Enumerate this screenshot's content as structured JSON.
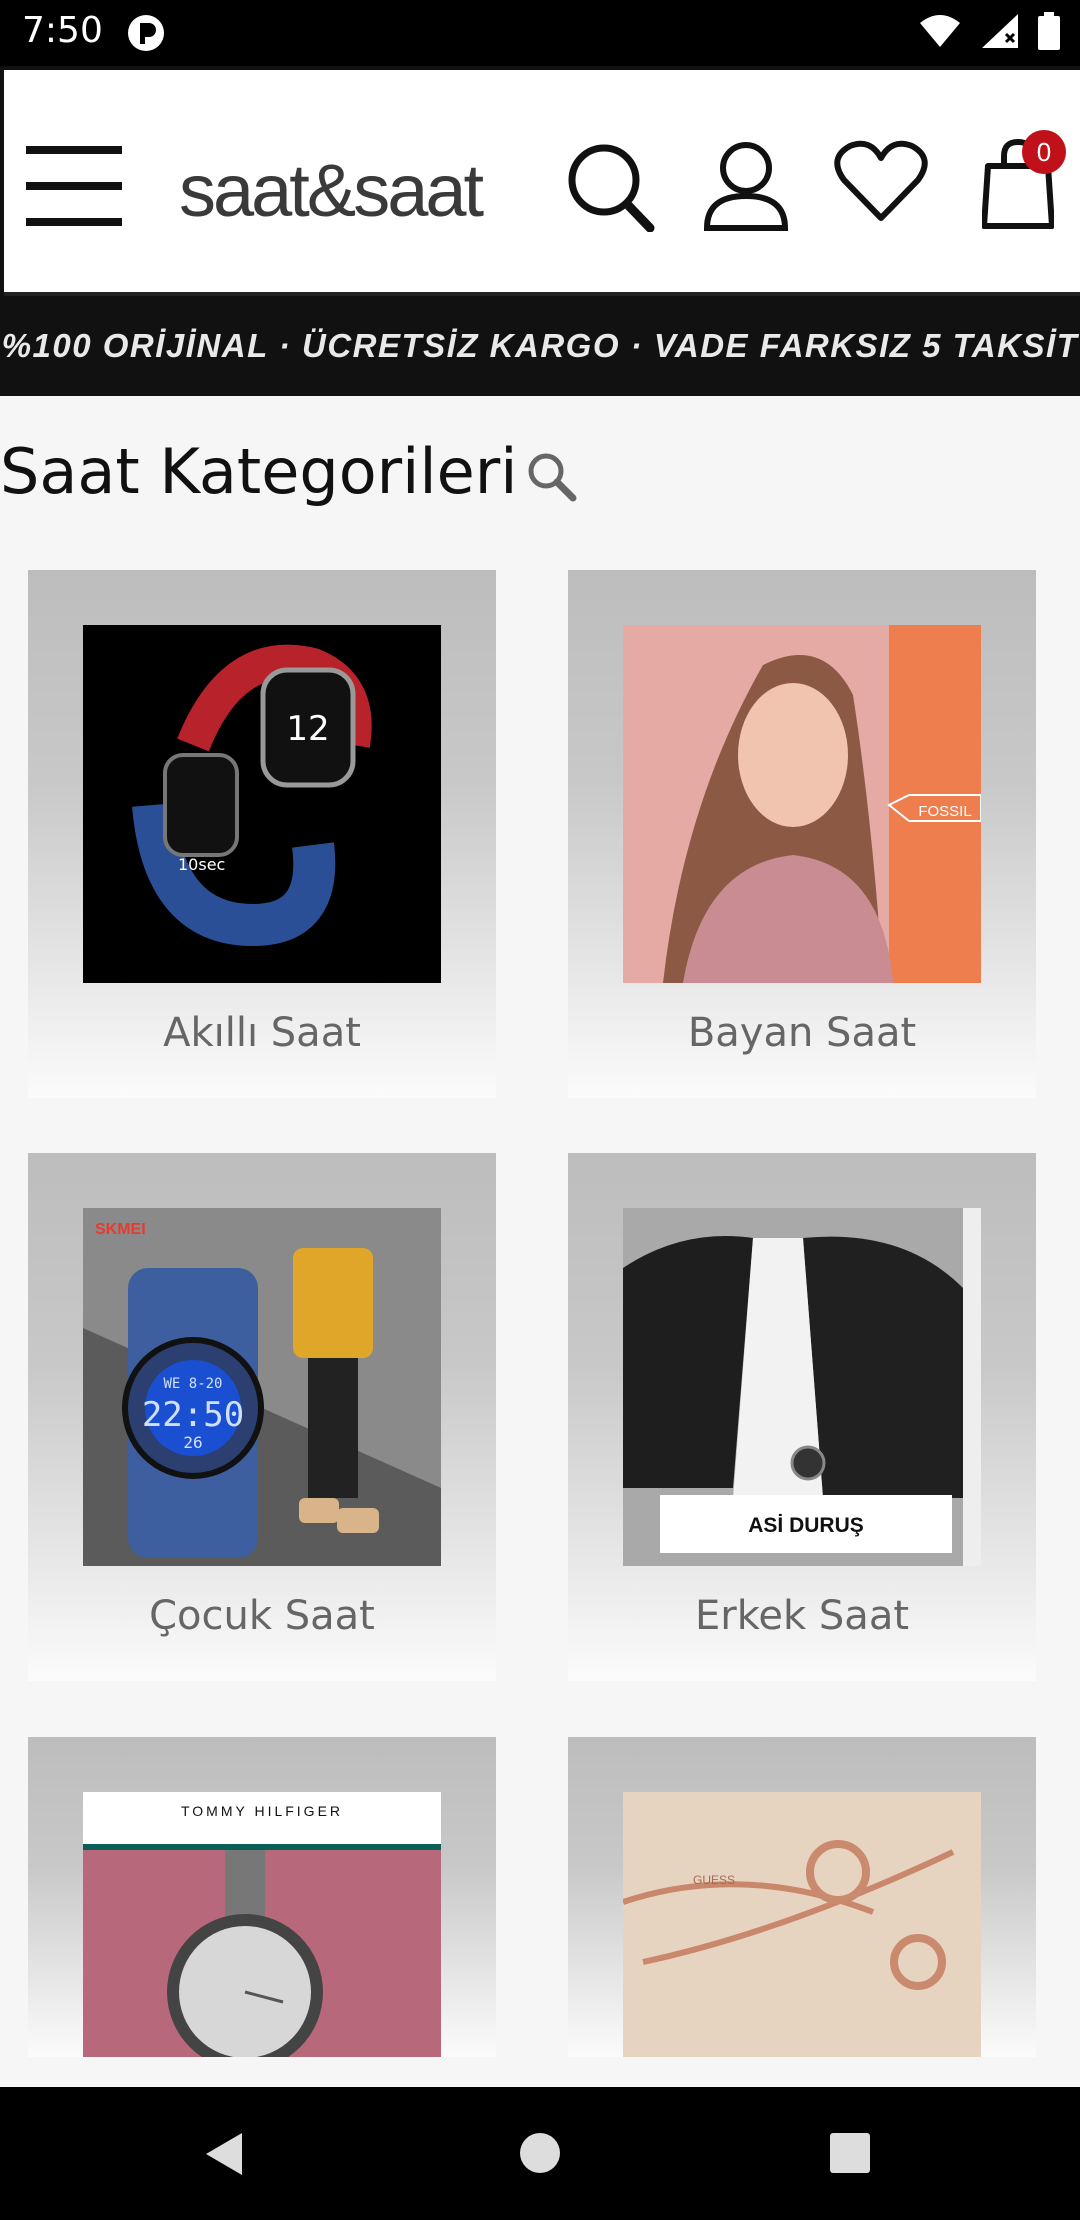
{
  "status_bar": {
    "time": "7:50",
    "icons": [
      "wifi-icon",
      "signal-icon",
      "battery-icon"
    ]
  },
  "header": {
    "brand": "saat&saat",
    "cart_count": "0",
    "icons": [
      "menu-icon",
      "search-icon",
      "account-icon",
      "wishlist-heart-icon",
      "cart-bag-icon"
    ]
  },
  "promo": {
    "text": "%100 ORİJİNAL · ÜCRETSİZ KARGO · VADE FARKSIZ 5 TAKSİT"
  },
  "section": {
    "title": "Saat Kategorileri"
  },
  "categories": [
    {
      "label": "Akıllı Saat"
    },
    {
      "label": "Bayan Saat",
      "image_text": "FOSSIL"
    },
    {
      "label": "Çocuk Saat",
      "image_text": "SKMEI",
      "watch_time": "22:50",
      "watch_top": "WE 8-20",
      "watch_bottom": "26"
    },
    {
      "label": "Erkek Saat",
      "image_text": "ASİ DURUŞ"
    },
    {
      "label": "",
      "image_text": "TOMMY HILFIGER"
    },
    {
      "label": "",
      "image_text": "GUESS"
    }
  ],
  "colors": {
    "accent": "#c0101a",
    "banner_bg": "#111111",
    "card_top": "#bdbdbd",
    "label": "#666666"
  }
}
